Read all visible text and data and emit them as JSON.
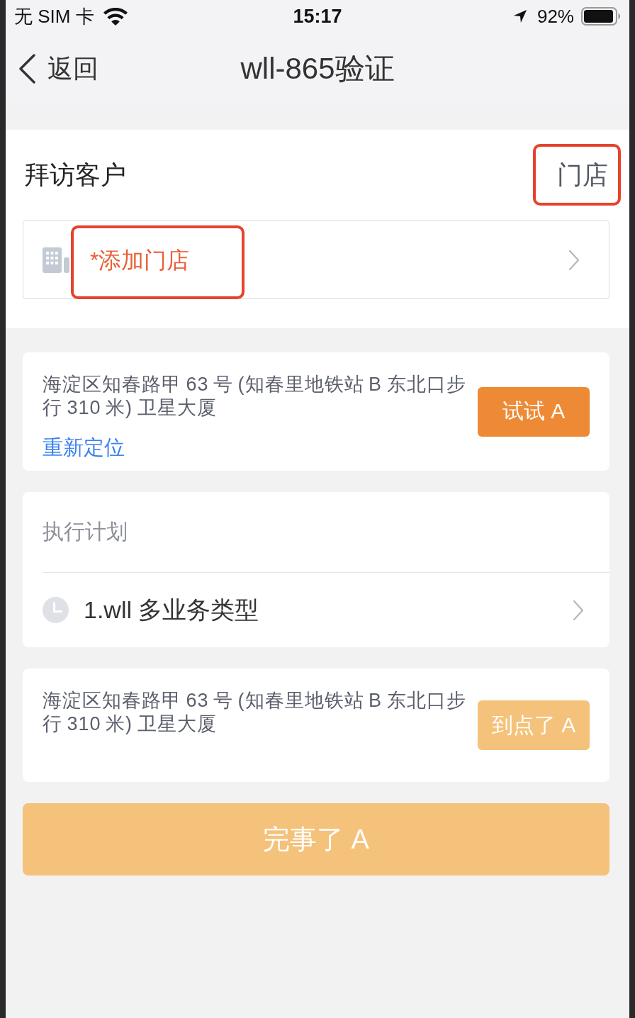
{
  "status_bar": {
    "carrier": "无 SIM 卡",
    "time": "15:17",
    "battery": "92%"
  },
  "nav_bar": {
    "back": "返回",
    "title": "wll-865验证"
  },
  "visit_section": {
    "label": "拜访客户",
    "type": {
      "text": "门店",
      "highlighted": true
    },
    "store_picker": {
      "label": "*添加门店",
      "highlighted": true
    }
  },
  "location_card": {
    "address": "海淀区知春路甲 63 号 (知春里地铁站 B 东北口步行 310 米) 卫星大厦",
    "relocate": "重新定位",
    "button": {
      "label": "试试 A",
      "disabled": false
    }
  },
  "plan": {
    "title": "执行计划",
    "items": [
      {
        "label": "1.wll 多业务类型"
      }
    ]
  },
  "arrival_card": {
    "address": "海淀区知春路甲 63 号 (知春里地铁站 B 东北口步行 310 米) 卫星大厦",
    "button": {
      "label": "到点了 A",
      "disabled": true
    }
  },
  "finish_button": {
    "label": "完事了 A",
    "disabled": true
  }
}
